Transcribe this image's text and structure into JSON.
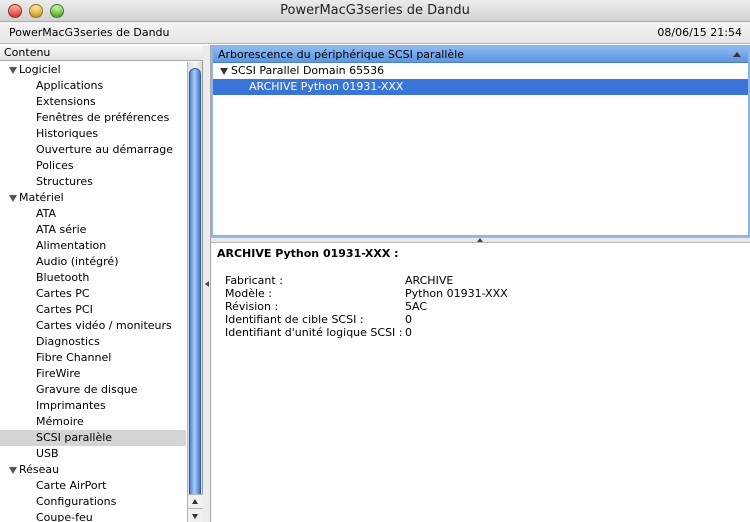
{
  "window": {
    "title": "PowerMacG3series de Dandu"
  },
  "infobar": {
    "machine": "PowerMacG3series de Dandu",
    "datetime": "08/06/15 21:54"
  },
  "sidebar": {
    "header": "Contenu",
    "groups": [
      {
        "label": "Logiciel",
        "items": [
          "Applications",
          "Extensions",
          "Fenêtres de préférences",
          "Historiques",
          "Ouverture au démarrage",
          "Polices",
          "Structures"
        ]
      },
      {
        "label": "Matériel",
        "items": [
          "ATA",
          "ATA série",
          "Alimentation",
          "Audio (intégré)",
          "Bluetooth",
          "Cartes PC",
          "Cartes PCI",
          "Cartes vidéo / moniteurs",
          "Diagnostics",
          "Fibre Channel",
          "FireWire",
          "Gravure de disque",
          "Imprimantes",
          "Mémoire",
          "SCSI parallèle",
          "USB"
        ]
      },
      {
        "label": "Réseau",
        "items": [
          "Carte AirPort",
          "Configurations",
          "Coupe-feu"
        ]
      }
    ],
    "selected": "SCSI parallèle"
  },
  "device_tree": {
    "header": "Arborescence du périphérique SCSI parallèle",
    "domain": "SCSI Parallel Domain 65536",
    "device": "ARCHIVE Python 01931-XXX"
  },
  "detail": {
    "title": "ARCHIVE Python 01931-XXX :",
    "properties": [
      {
        "key": "Fabricant :",
        "value": "ARCHIVE"
      },
      {
        "key": "Modèle :",
        "value": "Python 01931-XXX"
      },
      {
        "key": "Révision :",
        "value": "5AC"
      },
      {
        "key": "Identifiant de cible SCSI :",
        "value": "0"
      },
      {
        "key": "Identifiant d'unité logique SCSI :",
        "value": "0"
      }
    ]
  },
  "colors": {
    "selection_blue": "#3875d7",
    "header_blue": "#6fa3e8",
    "sidebar_selected": "#d4d4d4"
  }
}
